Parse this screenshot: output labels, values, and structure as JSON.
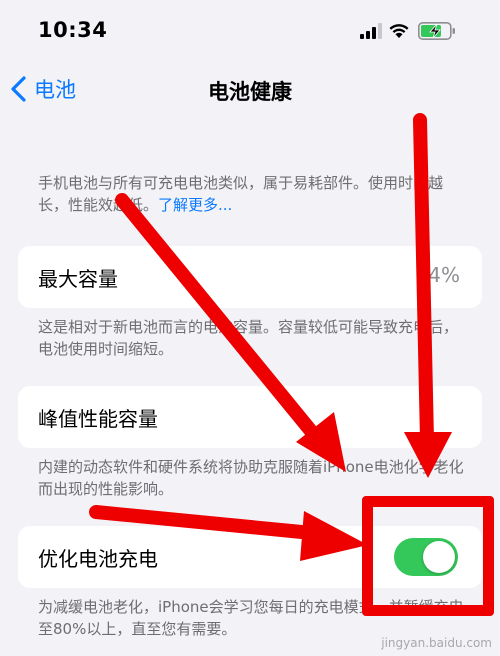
{
  "status_bar": {
    "time": "10:34",
    "icons": [
      "cellular-signal-icon",
      "wifi-icon",
      "battery-charging-icon"
    ]
  },
  "nav": {
    "back_label": "电池",
    "title": "电池健康"
  },
  "intro": {
    "text": "手机电池与所有可充电电池类似，属于易耗部件。使用时间越长，性能效越低。",
    "link": "了解更多..."
  },
  "max_capacity": {
    "label": "最大容量",
    "value": "94%",
    "description": "这是相对于新电池而言的电池容量。容量较低可能导致充电后，电池使用时间缩短。"
  },
  "peak_performance": {
    "label": "峰值性能容量",
    "description": "内建的动态软件和硬件系统将协助克服随着iPhone电池化学老化而出现的性能影响。"
  },
  "optimized_charging": {
    "label": "优化电池充电",
    "enabled": true,
    "description": "为减缓电池老化，iPhone会学习您每日的充电模式，并暂缓充电至80%以上，直至您有需要。"
  },
  "colors": {
    "accent": "#0a7aff",
    "toggle_on": "#34c759",
    "annotation": "#ee0000",
    "background": "#f2f2f7"
  },
  "watermark": "jingyan.baidu.com"
}
